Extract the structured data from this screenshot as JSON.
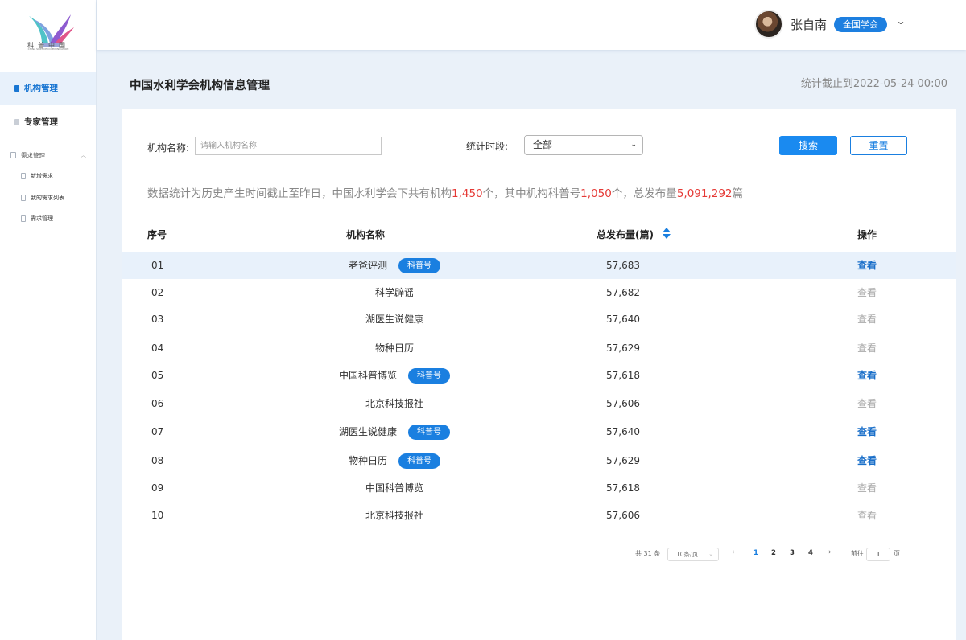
{
  "brand": {
    "logo_text": "科普中国",
    "logo_subtext": "CHINA SCIENCE COMMUNICATION",
    "colors": {
      "logo_teal": "#4fc3c8",
      "logo_purple": "#8e5bd0",
      "logo_pink": "#e0568a"
    }
  },
  "sidebar": {
    "items": [
      {
        "label": "机构管理",
        "active": true,
        "icon": "document-icon"
      },
      {
        "label": "专家管理",
        "active": false,
        "icon": "document-icon"
      }
    ],
    "group": {
      "label": "需求管理",
      "icon": "form-icon",
      "children": [
        {
          "label": "新增需求",
          "icon": "edit-doc-icon"
        },
        {
          "label": "我的需求列表",
          "icon": "list-doc-icon"
        },
        {
          "label": "需求管理",
          "icon": "manage-doc-icon"
        }
      ]
    }
  },
  "topbar": {
    "username": "张自南",
    "role": "全国学会"
  },
  "page": {
    "title": "中国水利学会机构信息管理",
    "stat_date": "统计截止到2022-05-24 00:00"
  },
  "filters": {
    "name_label": "机构名称:",
    "name_placeholder": "请输入机构名称",
    "period_label": "统计时段:",
    "period_value": "全部",
    "search_label": "搜索",
    "reset_label": "重置"
  },
  "summary": {
    "part1": "数据统计为历史产生时间截止至昨日，中国水利学会下共有机构",
    "count_orgs": "1,450",
    "part2": "个，其中机构科普号",
    "count_kpk": "1,050",
    "part3": "个，总发布量",
    "count_total": "5,091,292",
    "part4": "篇"
  },
  "table": {
    "headers": {
      "no": "序号",
      "name": "机构名称",
      "total": "总发布量(篇)",
      "action": "操作"
    },
    "tag_label": "科普号",
    "action_label": "查看",
    "rows": [
      {
        "no": "01",
        "name": "老爸评测",
        "tag": true,
        "total": "57,683",
        "action_enabled": true,
        "highlight": true
      },
      {
        "no": "02",
        "name": "科学辟谣",
        "tag": false,
        "total": "57,682",
        "action_enabled": false,
        "highlight": false
      },
      {
        "no": "03",
        "name": "湖医生说健康",
        "tag": false,
        "total": "57,640",
        "action_enabled": false,
        "highlight": false
      },
      {
        "no": "04",
        "name": "物种日历",
        "tag": false,
        "total": "57,629",
        "action_enabled": false,
        "highlight": false
      },
      {
        "no": "05",
        "name": "中国科普博览",
        "tag": true,
        "total": "57,618",
        "action_enabled": true,
        "highlight": false
      },
      {
        "no": "06",
        "name": "北京科技报社",
        "tag": false,
        "total": "57,606",
        "action_enabled": false,
        "highlight": false
      },
      {
        "no": "07",
        "name": "湖医生说健康",
        "tag": true,
        "total": "57,640",
        "action_enabled": true,
        "highlight": false
      },
      {
        "no": "08",
        "name": "物种日历",
        "tag": true,
        "total": "57,629",
        "action_enabled": true,
        "highlight": false
      },
      {
        "no": "09",
        "name": "中国科普博览",
        "tag": false,
        "total": "57,618",
        "action_enabled": false,
        "highlight": false
      },
      {
        "no": "10",
        "name": "北京科技报社",
        "tag": false,
        "total": "57,606",
        "action_enabled": false,
        "highlight": false
      }
    ]
  },
  "pagination": {
    "total_text": "共 31 条",
    "page_size": "10条/页",
    "pages": [
      "1",
      "2",
      "3",
      "4"
    ],
    "current_page": "1",
    "prev_glyph": "‹",
    "next_glyph": "›",
    "goto_label": "前往",
    "goto_value": "1",
    "goto_suffix": "页"
  },
  "colors": {
    "accent": "#1a7fe0",
    "highlight_num": "#e53935",
    "page_bg": "#eaf1f9"
  }
}
